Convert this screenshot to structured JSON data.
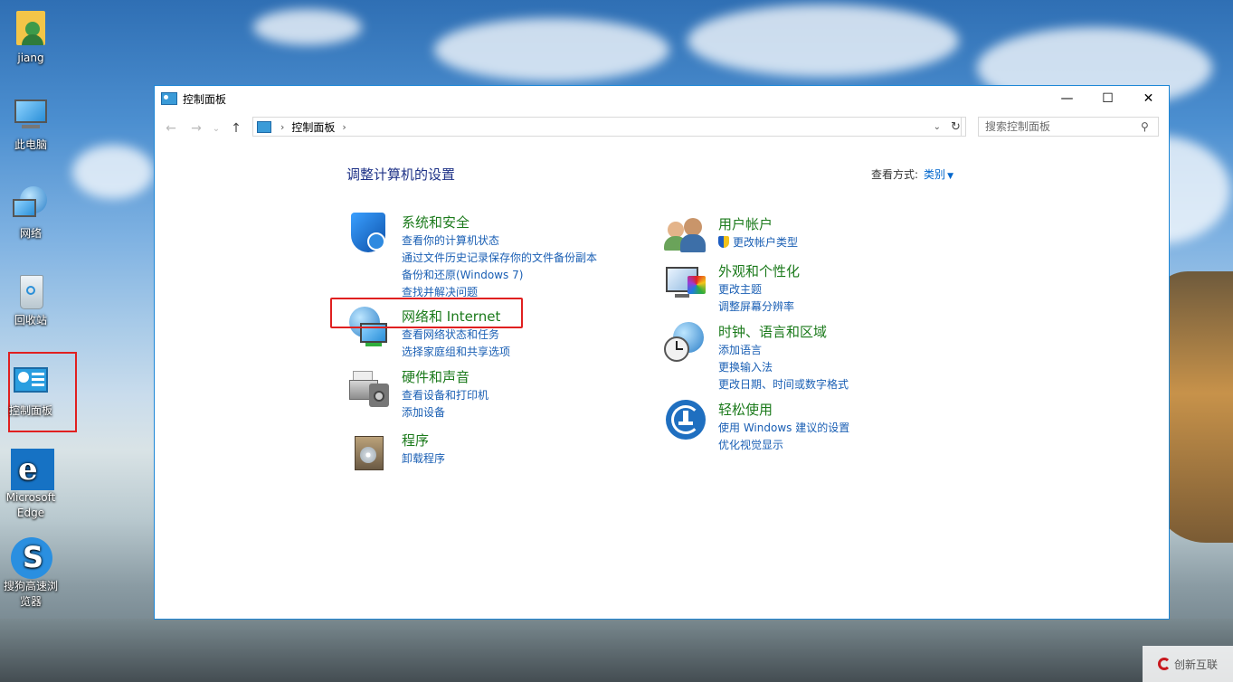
{
  "desktop": {
    "icons": [
      {
        "label": "jiang"
      },
      {
        "label": "此电脑"
      },
      {
        "label": "网络"
      },
      {
        "label": "回收站"
      },
      {
        "label": "控制面板"
      },
      {
        "label": "Microsoft Edge"
      },
      {
        "label": "搜狗高速浏览器"
      }
    ]
  },
  "window": {
    "title": "控制面板",
    "controls": {
      "minimize": "—",
      "maximize": "☐",
      "close": "✕"
    }
  },
  "nav": {
    "back": "←",
    "forward": "→",
    "recent": "⌄",
    "up": "↑",
    "breadcrumb": "控制面板",
    "breadcrumb_sep": "›",
    "dropdown": "⌄",
    "refresh": "↻"
  },
  "search": {
    "placeholder": "搜索控制面板"
  },
  "main": {
    "heading": "调整计算机的设置",
    "view_by_label": "查看方式:",
    "view_by_value": "类别",
    "categories": [
      {
        "title": "系统和安全",
        "links": [
          "查看你的计算机状态",
          "通过文件历史记录保存你的文件备份副本",
          "备份和还原(Windows 7)",
          "查找并解决问题"
        ]
      },
      {
        "title": "网络和 Internet",
        "links": [
          "查看网络状态和任务",
          "选择家庭组和共享选项"
        ]
      },
      {
        "title": "硬件和声音",
        "links": [
          "查看设备和打印机",
          "添加设备"
        ]
      },
      {
        "title": "程序",
        "links": [
          "卸载程序"
        ]
      },
      {
        "title": "用户帐户",
        "links": [
          "更改帐户类型"
        ]
      },
      {
        "title": "外观和个性化",
        "links": [
          "更改主题",
          "调整屏幕分辨率"
        ]
      },
      {
        "title": "时钟、语言和区域",
        "links": [
          "添加语言",
          "更换输入法",
          "更改日期、时间或数字格式"
        ]
      },
      {
        "title": "轻松使用",
        "links": [
          "使用 Windows 建议的设置",
          "优化视觉显示"
        ]
      }
    ]
  },
  "watermark": {
    "text": "创新互联"
  },
  "colors": {
    "accent": "#1e3287",
    "category_title": "#1b7a1b",
    "link": "#1a5fb4",
    "highlight": "#e02020",
    "window_border": "#1c86d6"
  }
}
